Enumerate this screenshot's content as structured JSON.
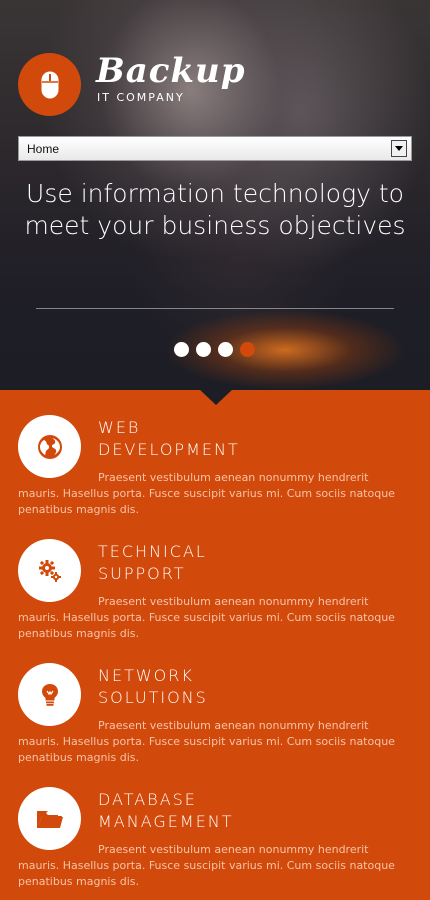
{
  "brand": {
    "name": "Backup",
    "tagline": "IT COMPANY",
    "logo_icon": "mouse-icon"
  },
  "nav": {
    "selected": "Home"
  },
  "hero": {
    "title": "Use information technology to meet your business objectives",
    "slides": {
      "count": 4,
      "active_index": 3
    }
  },
  "services": [
    {
      "title_line1": "WEB",
      "title_line2": "DEVELOPMENT",
      "icon": "globe-icon",
      "description": "Praesent vestibulum aenean nonummy hendrerit mauris. Hasellus porta. Fusce suscipit varius mi. Cum sociis natoque penatibus magnis dis."
    },
    {
      "title_line1": "TECHNICAL",
      "title_line2": "SUPPORT",
      "icon": "gears-icon",
      "description": "Praesent vestibulum aenean nonummy hendrerit mauris. Hasellus porta. Fusce suscipit varius mi. Cum sociis natoque penatibus magnis dis."
    },
    {
      "title_line1": "NETWORK",
      "title_line2": "SOLUTIONS",
      "icon": "lightbulb-icon",
      "description": "Praesent vestibulum aenean nonummy hendrerit mauris. Hasellus porta. Fusce suscipit varius mi. Cum sociis natoque penatibus magnis dis."
    },
    {
      "title_line1": "DATABASE",
      "title_line2": "MANAGEMENT",
      "icon": "folder-icon",
      "description": "Praesent vestibulum aenean nonummy hendrerit mauris. Hasellus porta. Fusce suscipit varius mi. Cum sociis natoque penatibus magnis dis."
    }
  ],
  "colors": {
    "accent": "#d24a0b",
    "hero_dark": "#1c1d25",
    "text_light": "#f6c3a8"
  }
}
